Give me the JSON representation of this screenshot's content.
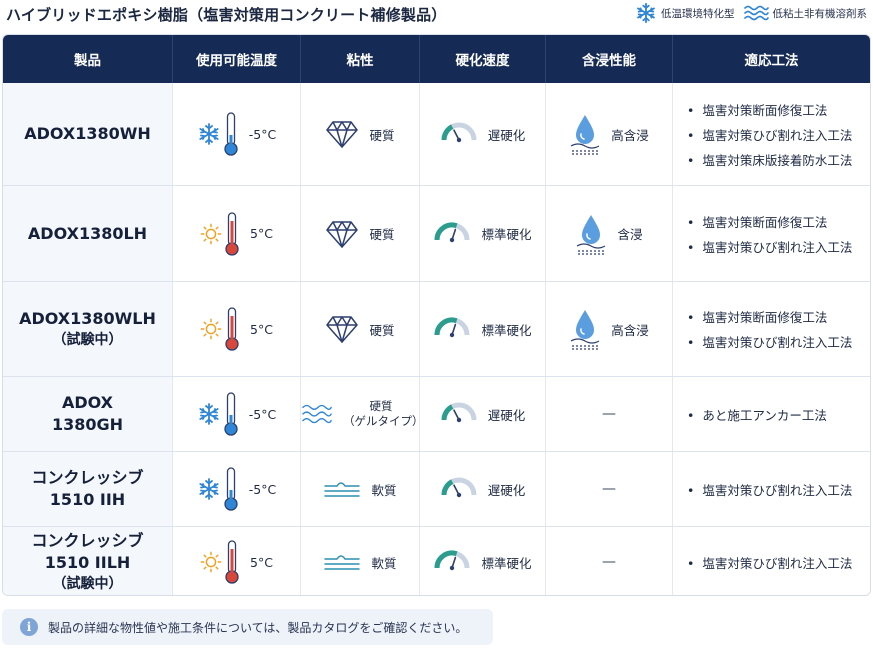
{
  "title": "ハイブリッドエポキシ樹脂（塩害対策用コンクリート補修製品）",
  "legend": [
    {
      "icon": "snowflake-icon",
      "label": "低温環境特化型"
    },
    {
      "icon": "waves-icon",
      "label": "低粘土非有機溶剤系"
    }
  ],
  "headers": [
    "製品",
    "使用可能温度",
    "粘性",
    "硬化速度",
    "含浸性能",
    "適応工法"
  ],
  "colors": {
    "header_bg": "#152b55",
    "cold_icon": "#2f86d6",
    "warm_icon": "#f0a020",
    "thermo_red": "#d9473b",
    "accent": "#2a9d8f"
  },
  "rows": [
    {
      "product": "ADOX1380WH",
      "product_sub": "",
      "temp_icon": "snowflake-icon",
      "temp": "-5°C",
      "visc_icon": "diamond-icon",
      "visc": "硬質",
      "visc_sub": "",
      "cure": "遅硬化",
      "cure_level": 0.35,
      "imp_icon": "droplet-icon",
      "imp": "高含浸",
      "methods": [
        "塩害対策断面修復工法",
        "塩害対策ひび割れ注入工法",
        "塩害対策床版接着防水工法"
      ]
    },
    {
      "product": "ADOX1380LH",
      "product_sub": "",
      "temp_icon": "sun-icon",
      "temp": "5°C",
      "visc_icon": "diamond-icon",
      "visc": "硬質",
      "visc_sub": "",
      "cure": "標準硬化",
      "cure_level": 0.6,
      "imp_icon": "droplet-icon",
      "imp": "含浸",
      "methods": [
        "塩害対策断面修復工法",
        "塩害対策ひび割れ注入工法"
      ]
    },
    {
      "product": "ADOX1380WLH",
      "product_sub": "（試験中）",
      "temp_icon": "sun-icon",
      "temp": "5°C",
      "visc_icon": "diamond-icon",
      "visc": "硬質",
      "visc_sub": "",
      "cure": "標準硬化",
      "cure_level": 0.6,
      "imp_icon": "droplet-icon",
      "imp": "高含浸",
      "methods": [
        "塩害対策断面修復工法",
        "塩害対策ひび割れ注入工法"
      ]
    },
    {
      "product": "ADOX",
      "product_sub": "1380GH",
      "temp_icon": "snowflake-icon",
      "temp": "-5°C",
      "visc_icon": "waves-icon",
      "visc": "硬質",
      "visc_sub": "（ゲルタイプ）",
      "cure": "遅硬化",
      "cure_level": 0.35,
      "imp_icon": "",
      "imp": "—",
      "methods": [
        "あと施工アンカー工法"
      ]
    },
    {
      "product": "コンクレッシブ",
      "product_sub": "1510 IIH",
      "temp_icon": "snowflake-icon",
      "temp": "-5°C",
      "visc_icon": "flow-icon",
      "visc": "軟質",
      "visc_sub": "",
      "cure": "遅硬化",
      "cure_level": 0.35,
      "imp_icon": "",
      "imp": "—",
      "methods": [
        "塩害対策ひび割れ注入工法"
      ]
    },
    {
      "product": "コンクレッシブ",
      "product_sub": "1510 IILH",
      "product_sub2": "（試験中）",
      "temp_icon": "sun-icon",
      "temp": "5°C",
      "visc_icon": "flow-icon",
      "visc": "軟質",
      "visc_sub": "",
      "cure": "標準硬化",
      "cure_level": 0.6,
      "imp_icon": "",
      "imp": "—",
      "methods": [
        "塩害対策ひび割れ注入工法"
      ]
    }
  ],
  "note": "製品の詳細な物性値や施工条件については、製品カタログをご確認ください。"
}
